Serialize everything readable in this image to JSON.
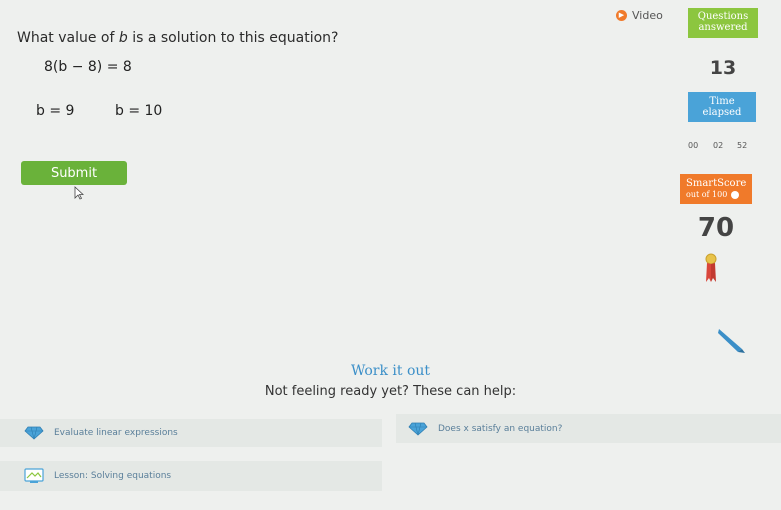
{
  "question": {
    "prefix": "What value of ",
    "variable": "b",
    "suffix": " is a solution to this equation?"
  },
  "equation": "8(b − 8) = 8",
  "choices": [
    "b = 9",
    "b = 10"
  ],
  "submit_label": "Submit",
  "sidebar": {
    "video_label": "Video",
    "questions_answered": {
      "line1": "Questions",
      "line2": "answered",
      "count": "13"
    },
    "time_elapsed": {
      "line1": "Time",
      "line2": "elapsed",
      "hours": "00",
      "minutes": "02",
      "seconds": "52"
    },
    "smartscore": {
      "title": "SmartScore",
      "subtitle": "out of 100",
      "value": "70"
    }
  },
  "help": {
    "title": "Work it out",
    "subtitle": "Not feeling ready yet? These can help:",
    "links": [
      {
        "label": "Evaluate linear expressions",
        "icon": "diamond-icon"
      },
      {
        "label": "Does x satisfy an equation?",
        "icon": "diamond-icon"
      },
      {
        "label": "Lesson: Solving equations",
        "icon": "lesson-icon"
      }
    ]
  },
  "colors": {
    "questions_box": "#8cc63f",
    "time_box": "#4aa3d8",
    "smartscore_box": "#f07a2a",
    "submit_button": "#6ab23a",
    "help_title": "#3b8fc8"
  }
}
